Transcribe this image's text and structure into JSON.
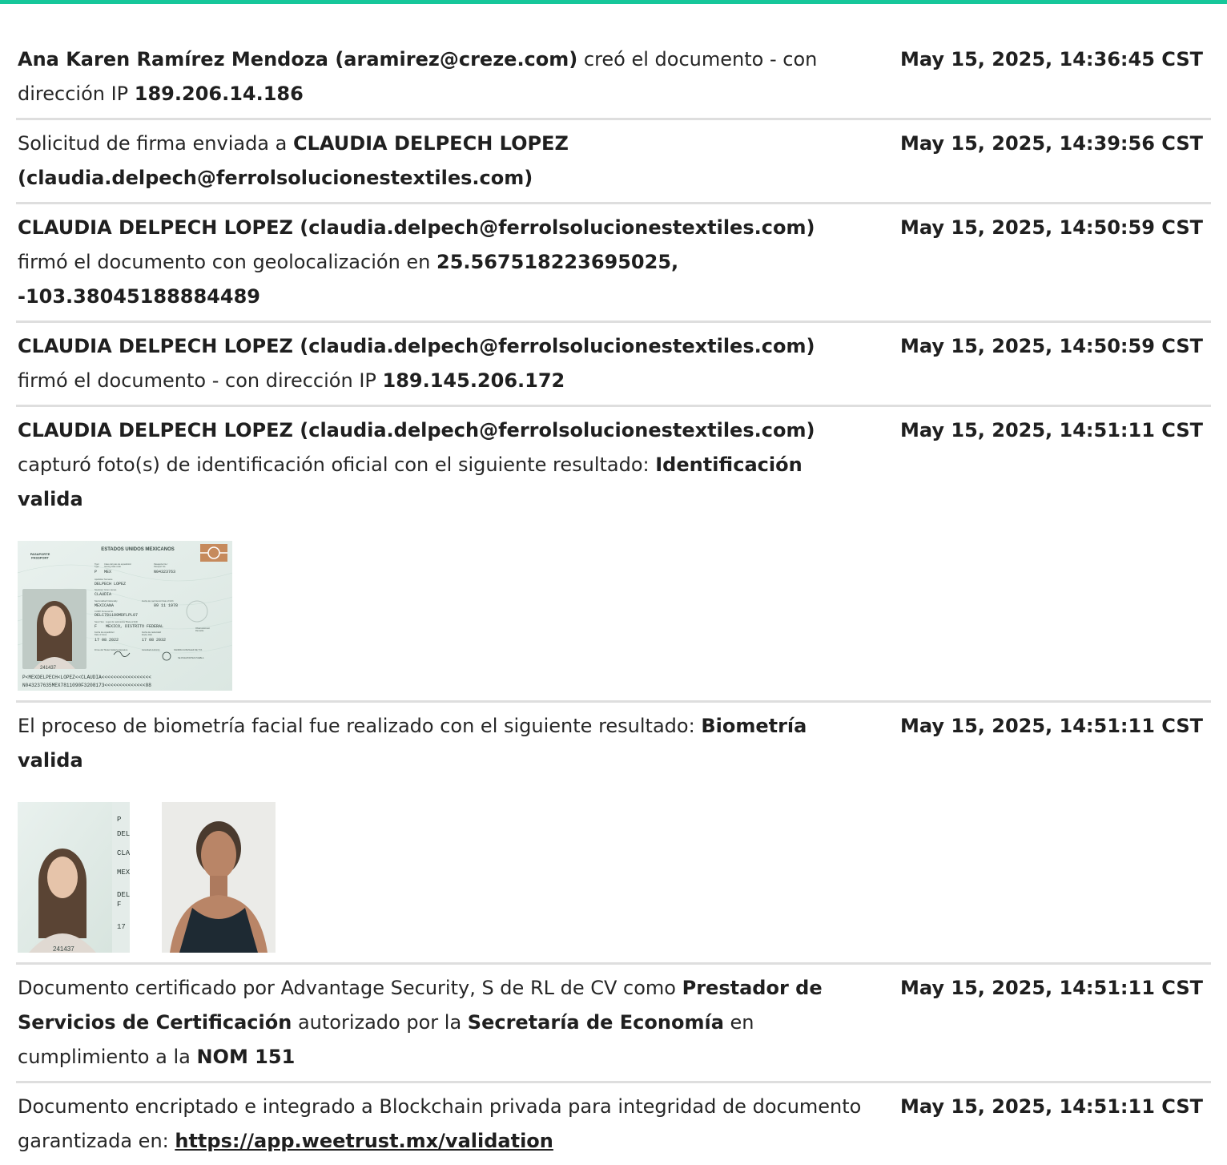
{
  "entries": [
    {
      "segments": [
        {
          "t": "Ana Karen Ramírez Mendoza (aramirez@creze.com)",
          "b": true
        },
        {
          "t": " creó el documento - con dirección IP "
        },
        {
          "t": "189.206.14.186",
          "b": true
        }
      ],
      "time": "May 15, 2025, 14:36:45 CST"
    },
    {
      "segments": [
        {
          "t": "Solicitud de firma enviada a "
        },
        {
          "t": "CLAUDIA DELPECH LOPEZ (claudia.delpech@ferrolsolucionestextiles.com)",
          "b": true
        }
      ],
      "time": "May 15, 2025, 14:39:56 CST"
    },
    {
      "segments": [
        {
          "t": "CLAUDIA DELPECH LOPEZ (claudia.delpech@ferrolsolucionestextiles.com)",
          "b": true
        },
        {
          "t": " firmó el documento con geolocalización en "
        },
        {
          "t": "25.567518223695025, -103.38045188884489",
          "b": true
        }
      ],
      "time": "May 15, 2025, 14:50:59 CST"
    },
    {
      "segments": [
        {
          "t": "CLAUDIA DELPECH LOPEZ (claudia.delpech@ferrolsolucionestextiles.com)",
          "b": true
        },
        {
          "t": " firmó el documento - con dirección IP "
        },
        {
          "t": "189.145.206.172",
          "b": true
        }
      ],
      "time": "May 15, 2025, 14:50:59 CST"
    },
    {
      "segments": [
        {
          "t": "CLAUDIA DELPECH LOPEZ (claudia.delpech@ferrolsolucionestextiles.com)",
          "b": true
        },
        {
          "t": " capturó foto(s) de identificación oficial con el siguiente resultado: "
        },
        {
          "t": "Identificación valida",
          "b": true
        }
      ],
      "time": "May 15, 2025, 14:51:11 CST",
      "photos": [
        "passport"
      ]
    },
    {
      "segments": [
        {
          "t": "El proceso de biometría facial fue realizado con el siguiente resultado: "
        },
        {
          "t": "Biometría valida",
          "b": true
        }
      ],
      "time": "May 15, 2025, 14:51:11 CST",
      "photos": [
        "passport-face",
        "selfie"
      ]
    },
    {
      "segments": [
        {
          "t": "Documento certificado por Advantage Security, S de RL de CV como "
        },
        {
          "t": "Prestador de Servicios de Certificación",
          "b": true
        },
        {
          "t": " autorizado por la "
        },
        {
          "t": "Secretaría de Economía",
          "b": true
        },
        {
          "t": " en cumplimiento a la "
        },
        {
          "t": "NOM 151",
          "b": true
        }
      ],
      "time": "May 15, 2025, 14:51:11 CST"
    },
    {
      "segments": [
        {
          "t": "Documento encriptado e integrado a Blockchain privada para integridad de documento garantizada en: "
        },
        {
          "t": "https://app.weetrust.mx/validation",
          "b": true,
          "link": true
        }
      ],
      "time": "May 15, 2025, 14:51:11 CST"
    }
  ],
  "passport": {
    "country": "ESTADOS UNIDOS MEXICANOS",
    "doc_label": "PASAPORTE\nPASSPORT",
    "type_label": "Tipo/\nType",
    "type_value": "P",
    "code_label": "Clave del país de expedición/\nIssuing state code",
    "code_value": "MEX",
    "number_label": "Pasaporte No./\nPassport No.",
    "number_value": "N04323763",
    "surname_label": "Apellidos/ Surname",
    "surname_value": "DELPECH LOPEZ",
    "given_label": "Nombres/ Given names",
    "given_value": "CLAUDIA",
    "nationality_label": "Nacionalidad/ Nationality",
    "nationality_value": "MEXICANA",
    "dob_label": "Fecha de nacimiento/ Date of birth",
    "dob_value": "09 11 1978",
    "curp_label": "CURP/ Personal No.",
    "curp_value": "DELC781109MDFLPL07",
    "sex_label": "Sexo/ Sex",
    "sex_value": "F",
    "pob_label": "Lugar de nacimiento/ Place of birth",
    "pob_value": "MEXICO, DISTRITO FEDERAL",
    "issue_label": "Fecha de expedición/\nDate of issue",
    "issue_value": "17 08 2022",
    "expiry_label": "Fecha de caducidad/\nExpiry date",
    "expiry_value": "17 08 2032",
    "obs_label": "Observaciones/\nRemarks",
    "signature_label": "Firma del Titular/ Holder's Signature",
    "authority_label": "Autoridad/ Authority",
    "authority_value": "SANDRA GONZALEZ DE YTA",
    "office_value": "SE PASAPORTES PUEBLA",
    "photo_number": "241437",
    "mrz1": "P<MEXDELPECH<LOPEZ<<CLAUDIA<<<<<<<<<<<<<<<<<",
    "mrz2": "N043237635MEX7811090F3208173<<<<<<<<<<<<<<08"
  },
  "colors": {
    "accent_bar": "#16c79a",
    "divider": "#dedede",
    "text": "#262626"
  }
}
